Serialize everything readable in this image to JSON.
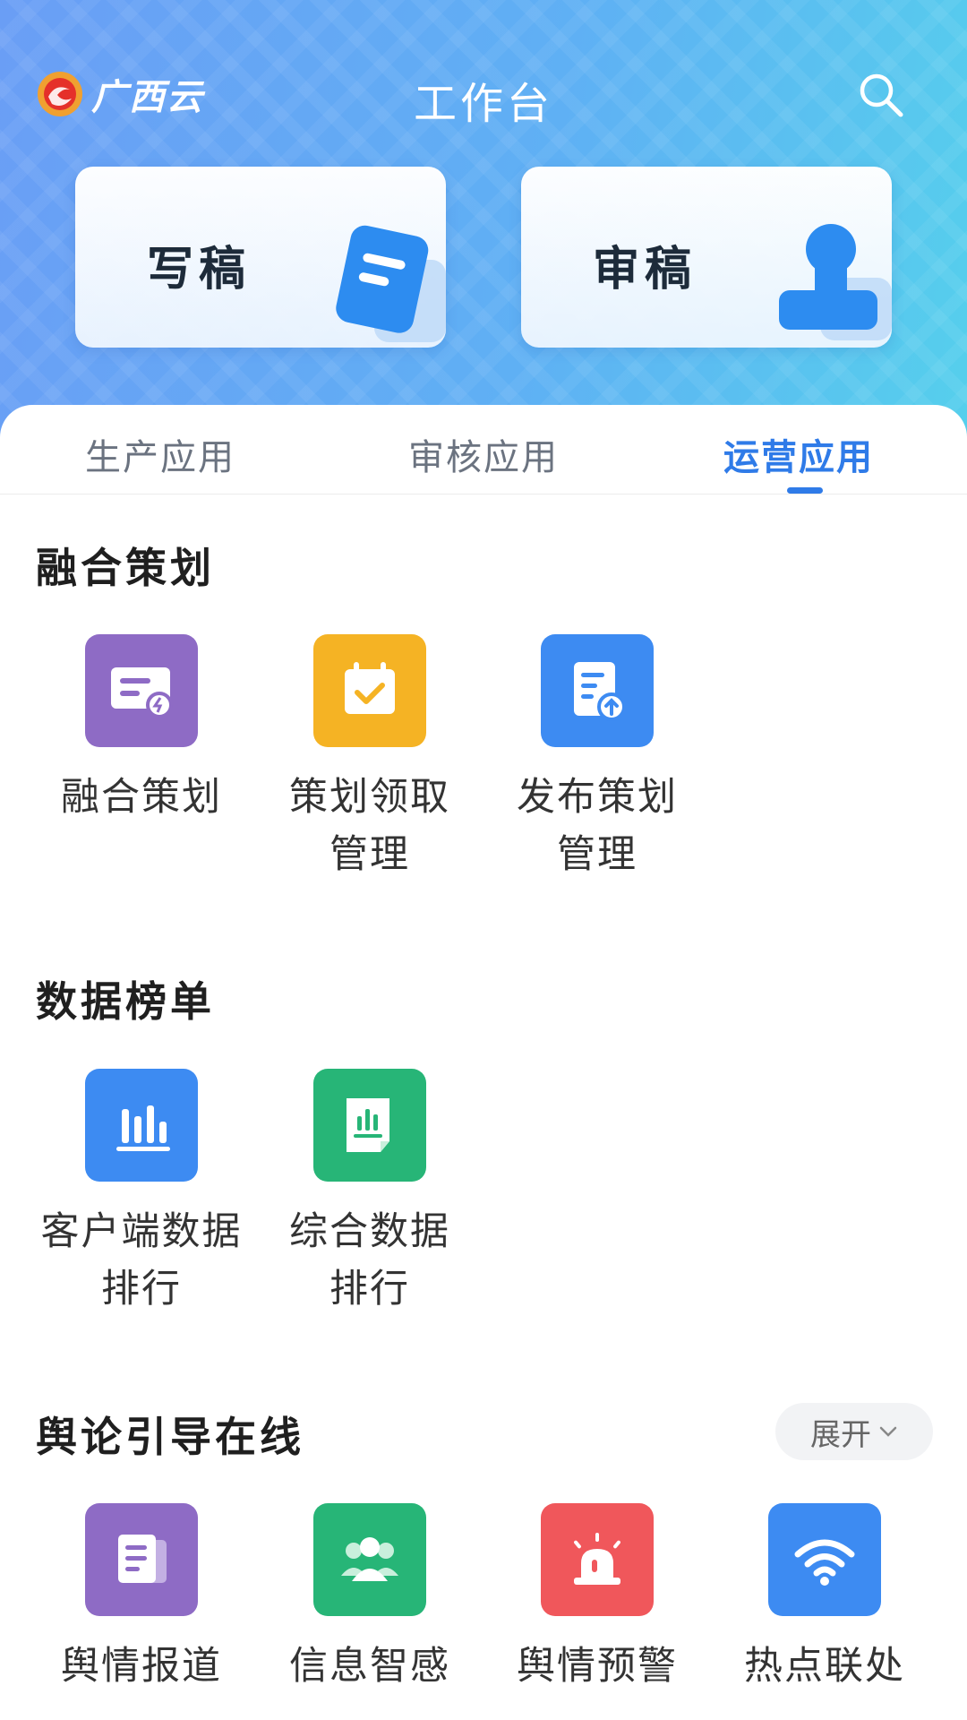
{
  "header": {
    "logo_text": "广西云",
    "title": "工作台"
  },
  "quick_actions": [
    {
      "label": "写稿",
      "icon": "document-icon",
      "color": "#2d8cf0"
    },
    {
      "label": "审稿",
      "icon": "stamp-icon",
      "color": "#2d8cf0"
    }
  ],
  "tabs": [
    {
      "label": "生产应用",
      "active": false
    },
    {
      "label": "审核应用",
      "active": false
    },
    {
      "label": "运营应用",
      "active": true
    }
  ],
  "sections": [
    {
      "title": "融合策划",
      "items": [
        {
          "label": "融合策划",
          "icon": "plan-card-icon",
          "color": "#8e6bc5"
        },
        {
          "label": "策划领取\n管理",
          "icon": "calendar-check-icon",
          "color": "#f5b324"
        },
        {
          "label": "发布策划\n管理",
          "icon": "document-upload-icon",
          "color": "#3d8bf2"
        }
      ]
    },
    {
      "title": "数据榜单",
      "items": [
        {
          "label": "客户端数据\n排行",
          "icon": "bar-chart-icon",
          "color": "#3d8bf2"
        },
        {
          "label": "综合数据\n排行",
          "icon": "report-chart-icon",
          "color": "#27b577"
        }
      ]
    },
    {
      "title": "舆论引导在线",
      "expand_label": "展开",
      "items": [
        {
          "label": "舆情报道",
          "icon": "news-icon",
          "color": "#8e6bc5"
        },
        {
          "label": "信息智感",
          "icon": "group-icon",
          "color": "#27b577"
        },
        {
          "label": "舆情预警",
          "icon": "alarm-icon",
          "color": "#f0575b"
        },
        {
          "label": "热点联处",
          "icon": "wifi-icon",
          "color": "#3d8bf2"
        }
      ]
    }
  ]
}
